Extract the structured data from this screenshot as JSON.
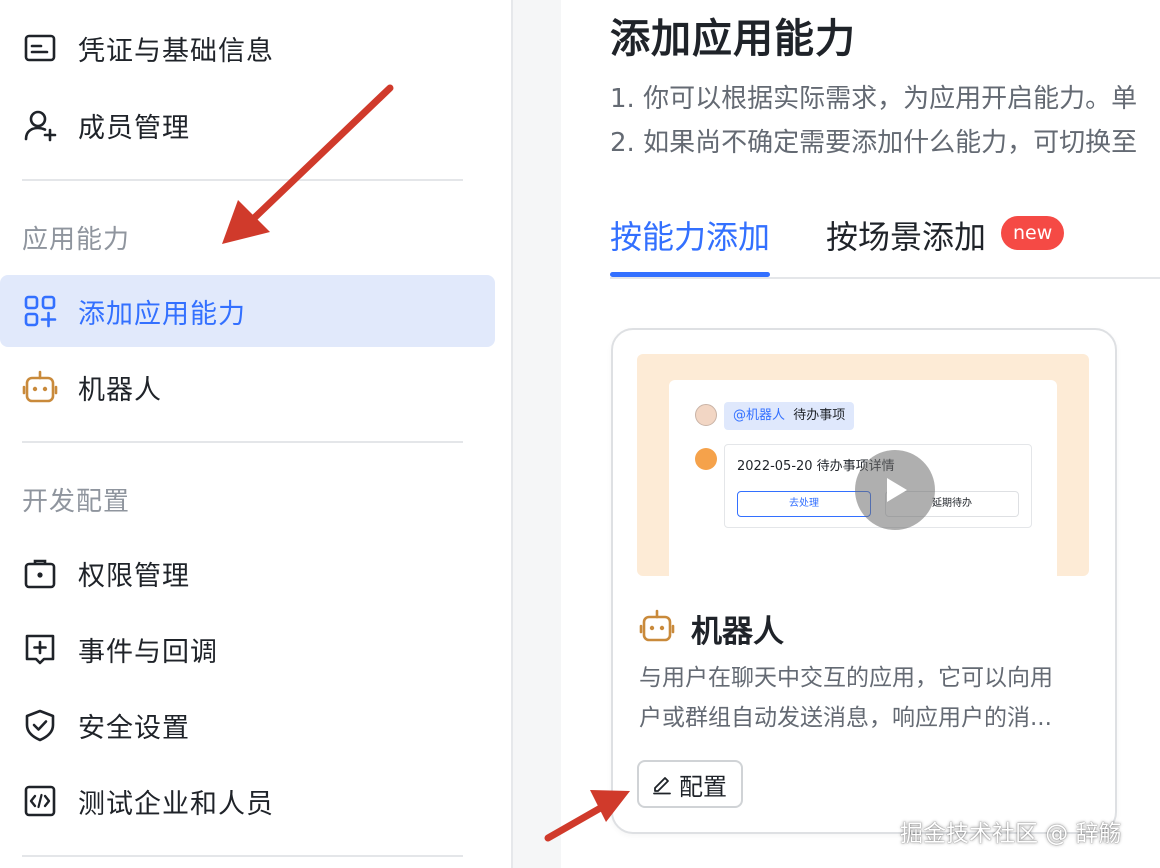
{
  "sidebar": {
    "items_top": [
      {
        "label": "凭证与基础信息",
        "icon": "credential-icon"
      },
      {
        "label": "成员管理",
        "icon": "member-add-icon"
      }
    ],
    "group_app": {
      "title": "应用能力"
    },
    "items_app": [
      {
        "label": "添加应用能力",
        "icon": "app-grid-add-icon",
        "active": true
      },
      {
        "label": "机器人",
        "icon": "robot-icon"
      }
    ],
    "group_dev": {
      "title": "开发配置"
    },
    "items_dev": [
      {
        "label": "权限管理",
        "icon": "briefcase-lock-icon"
      },
      {
        "label": "事件与回调",
        "icon": "event-plus-icon"
      },
      {
        "label": "安全设置",
        "icon": "shield-check-icon"
      },
      {
        "label": "测试企业和人员",
        "icon": "code-box-icon"
      }
    ]
  },
  "main": {
    "title": "添加应用能力",
    "desc_1": "1. 你可以根据实际需求，为应用开启能力。单",
    "desc_2": "2. 如果尚不确定需要添加什么能力，可切换至",
    "tabs": [
      {
        "label": "按能力添加",
        "active": true
      },
      {
        "label": "按场景添加",
        "badge": "new"
      }
    ],
    "card": {
      "preview": {
        "mention": "@机器人",
        "mention_text": "待办事项",
        "message": "2022-05-20 待办事项详情",
        "primary_btn": "去处理",
        "secondary_btn": "延期待办"
      },
      "title": "机器人",
      "desc_line1": "与用户在聊天中交互的应用，它可以向用",
      "desc_line2": "户或群组自动发送消息，响应用户的消...",
      "config_label": "配置"
    }
  },
  "watermark": "掘金技术社区 @ 辞觞",
  "colors": {
    "accent": "#3370ff",
    "active_bg": "#e1e9fb",
    "badge": "#f54a45",
    "robot": "#c98a3b",
    "annotation_arrow": "#d03a2b"
  }
}
